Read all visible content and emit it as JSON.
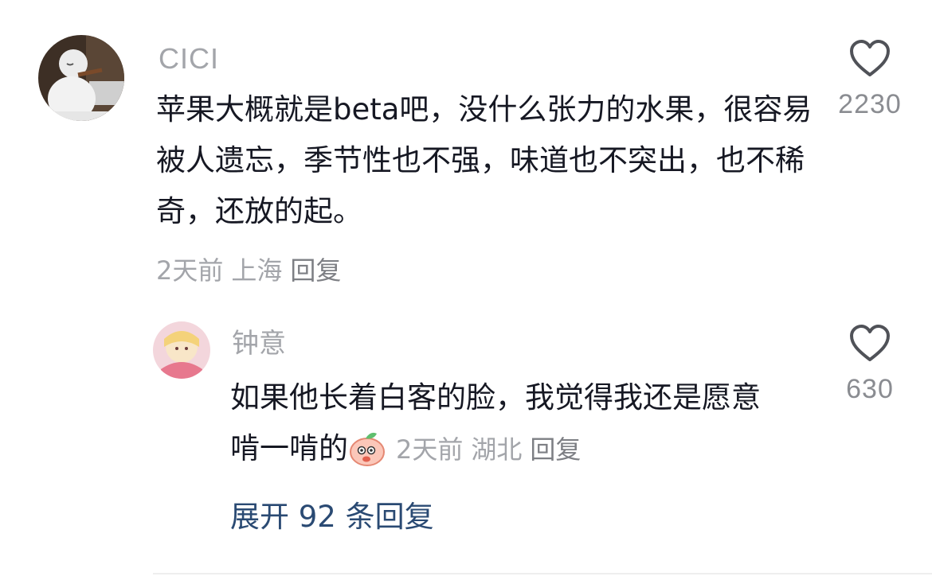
{
  "comment": {
    "author": "CICI",
    "text": "苹果大概就是beta吧，没什么张力的水果，很容易被人遗忘，季节性也不强，味道也不突出，也不稀奇，还放的起。",
    "time": "2天前",
    "location": "上海",
    "reply_label": "回复",
    "likes": "2230"
  },
  "reply": {
    "author": "钟意",
    "text": "如果他长着白客的脸，我觉得我还是愿意啃一啃的",
    "time": "2天前",
    "location": "湖北",
    "reply_label": "回复",
    "likes": "630"
  },
  "expand_label": "展开 92 条回复",
  "icons": {
    "like": "heart-outline-icon",
    "emoji": "peach-emoji-icon"
  },
  "colors": {
    "secondary_text": "#a3a5aa",
    "link": "#2a4a73"
  }
}
